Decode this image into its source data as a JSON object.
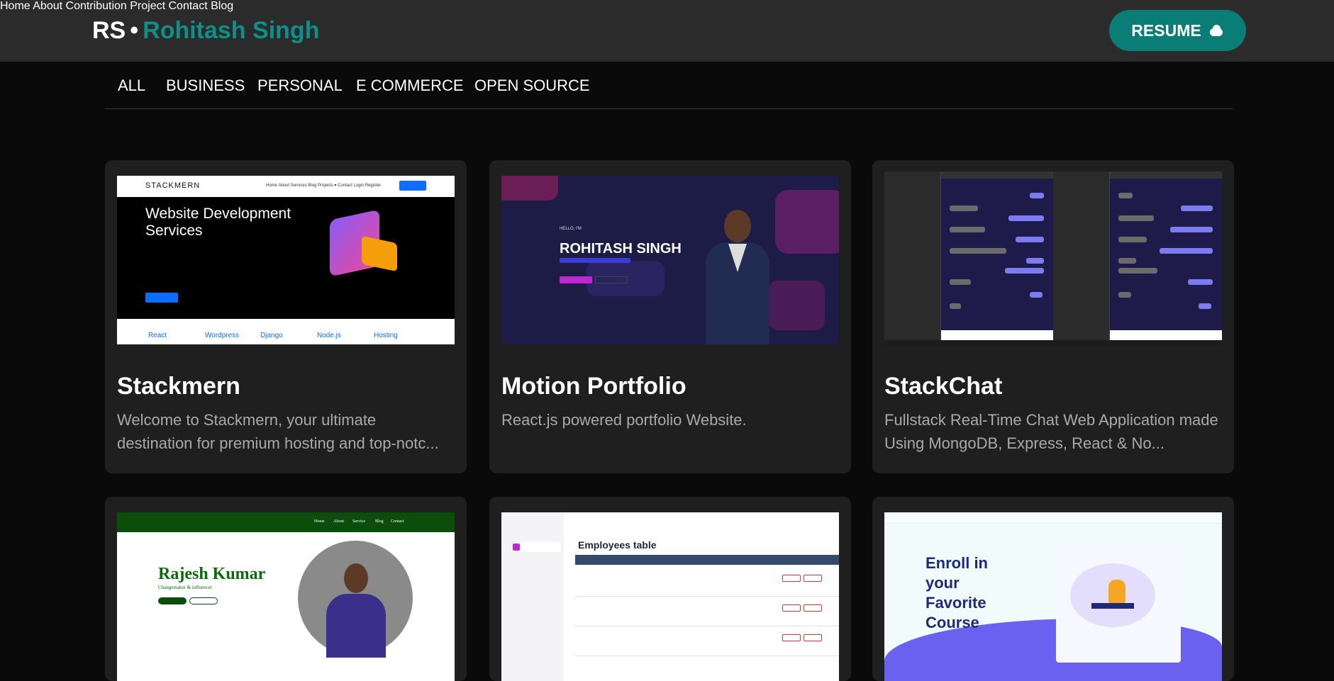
{
  "brand": {
    "initials": "RS",
    "separator": "•",
    "name": "Rohitash Singh"
  },
  "nav": {
    "items": [
      "Home",
      "About",
      "Contribution",
      "Project",
      "Contact",
      "Blog"
    ],
    "resume_label": "RESUME",
    "resume_icon": "cloud-download-icon"
  },
  "filters": [
    "ALL",
    "BUSINESS",
    "PERSONAL",
    "E COMMERCE",
    "OPEN SOURCE"
  ],
  "projects": [
    {
      "title": "Stackmern",
      "description": "Welcome to Stackmern, your ultimate destination for premium hosting and top-notc...",
      "thumb": {
        "logo": "STACKMERN",
        "hero": "Website Development Services",
        "links": "Home  About  Services  Blog  Projects ▾  Contact  Login  Register",
        "footer": [
          "React",
          "Wordpress",
          "Django",
          "Node.js",
          "Hosting"
        ]
      }
    },
    {
      "title": "Motion Portfolio",
      "description": "React.js powered portfolio Website.",
      "thumb": {
        "hello": "HELLO, I'M",
        "name": "ROHITASH SINGH"
      }
    },
    {
      "title": "StackChat",
      "description": "Fullstack Real-Time Chat Web Application made Using MongoDB, Express, React & No..."
    },
    {
      "title": "",
      "description": "",
      "thumb": {
        "nav": [
          "Home",
          "About",
          "Service",
          "Blog",
          "Contact"
        ],
        "name": "Rajesh Kumar",
        "tagline": "Changemaker & influencer"
      }
    },
    {
      "title": "",
      "description": "",
      "thumb": {
        "heading": "Employees table"
      }
    },
    {
      "title": "",
      "description": "",
      "thumb": {
        "heading": "Enroll in your Favorite Course"
      }
    }
  ]
}
